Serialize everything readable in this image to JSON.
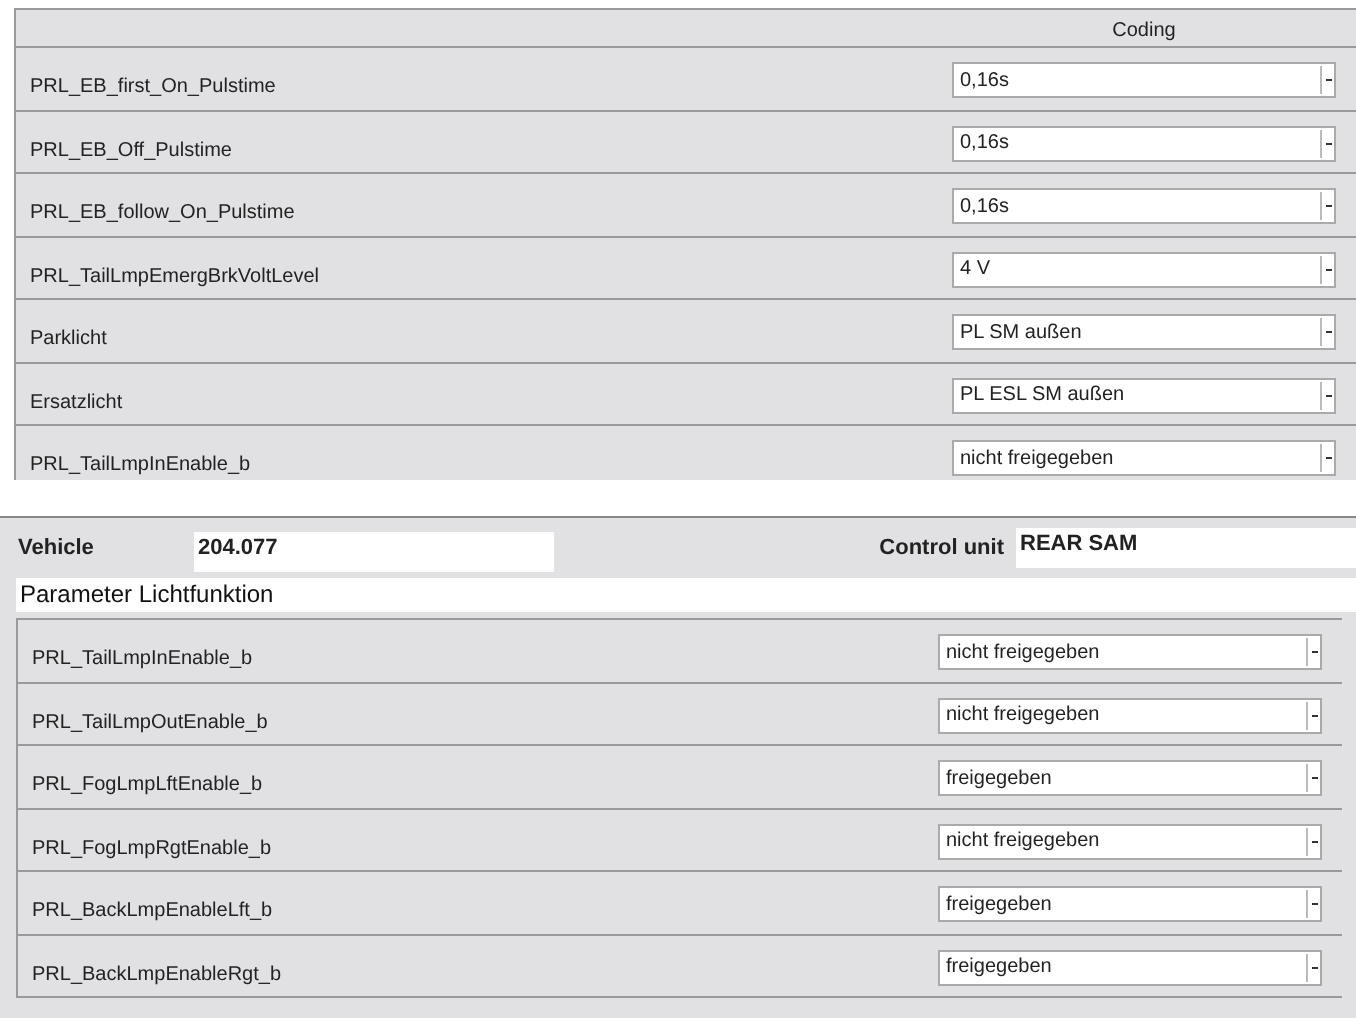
{
  "coding_table": {
    "header": "Coding",
    "rows": [
      {
        "name": "PRL_EB_first_On_Pulstime",
        "value": "0,16s"
      },
      {
        "name": "PRL_EB_Off_Pulstime",
        "value": "0,16s"
      },
      {
        "name": "PRL_EB_follow_On_Pulstime",
        "value": "0,16s"
      },
      {
        "name": "PRL_TailLmpEmergBrkVoltLevel",
        "value": "4 V"
      },
      {
        "name": "Parklicht",
        "value": "PL SM außen"
      },
      {
        "name": "Ersatzlicht",
        "value": "PL ESL SM außen"
      },
      {
        "name": "PRL_TailLmpInEnable_b",
        "value": "nicht freigegeben"
      }
    ]
  },
  "vehicle": {
    "label": "Vehicle",
    "value": "204.077"
  },
  "control_unit": {
    "label": "Control unit",
    "value": "REAR SAM"
  },
  "section_title": "Parameter Lichtfunktion",
  "parameter_table": {
    "rows": [
      {
        "name": "PRL_TailLmpInEnable_b",
        "value": "nicht freigegeben"
      },
      {
        "name": "PRL_TailLmpOutEnable_b",
        "value": "nicht freigegeben"
      },
      {
        "name": "PRL_FogLmpLftEnable_b",
        "value": "freigegeben"
      },
      {
        "name": "PRL_FogLmpRgtEnable_b",
        "value": "nicht freigegeben"
      },
      {
        "name": "PRL_BackLmpEnableLft_b",
        "value": "freigegeben"
      },
      {
        "name": "PRL_BackLmpEnableRgt_b",
        "value": "freigegeben"
      }
    ]
  }
}
